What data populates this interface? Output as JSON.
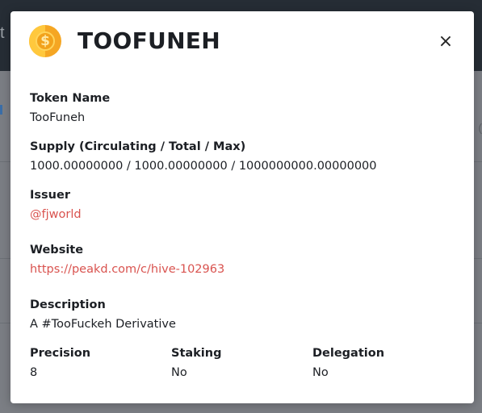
{
  "background": {
    "header_fragment": "t",
    "right_fragment": "("
  },
  "modal": {
    "icon": "gold-coin-icon",
    "title": "TOOFUNEH",
    "close_glyph": "×",
    "fields": {
      "token_name": {
        "label": "Token Name",
        "value": "TooFuneh"
      },
      "supply": {
        "label": "Supply (Circulating / Total / Max)",
        "value": "1000.00000000 / 1000.00000000 / 1000000000.00000000"
      },
      "issuer": {
        "label": "Issuer",
        "value": "@fjworld"
      },
      "website": {
        "label": "Website",
        "value": "https://peakd.com/c/hive-102963"
      },
      "description": {
        "label": "Description",
        "value": "A #TooFuckeh Derivative"
      },
      "precision": {
        "label": "Precision",
        "value": "8"
      },
      "staking": {
        "label": "Staking",
        "value": "No"
      },
      "delegation": {
        "label": "Delegation",
        "value": "No"
      }
    }
  },
  "colors": {
    "link": "#d9534f",
    "overlay": "#7b7e84",
    "header_bg": "#262d35",
    "coin": "#f5a623"
  }
}
